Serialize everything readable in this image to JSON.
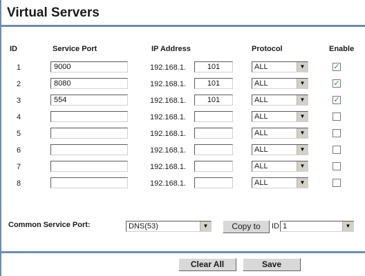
{
  "page": {
    "title": "Virtual Servers"
  },
  "table": {
    "headers": {
      "id": "ID",
      "service_port": "Service Port",
      "ip_address": "IP Address",
      "protocol": "Protocol",
      "enable": "Enable"
    },
    "ip_prefix": "192.168.1.",
    "rows": [
      {
        "id": "1",
        "port": "9000",
        "ip_suffix": "101",
        "protocol": "ALL",
        "enabled": true
      },
      {
        "id": "2",
        "port": "8080",
        "ip_suffix": "101",
        "protocol": "ALL",
        "enabled": true
      },
      {
        "id": "3",
        "port": "554",
        "ip_suffix": "101",
        "protocol": "ALL",
        "enabled": true
      },
      {
        "id": "4",
        "port": "",
        "ip_suffix": "",
        "protocol": "ALL",
        "enabled": false
      },
      {
        "id": "5",
        "port": "",
        "ip_suffix": "",
        "protocol": "ALL",
        "enabled": false
      },
      {
        "id": "6",
        "port": "",
        "ip_suffix": "",
        "protocol": "ALL",
        "enabled": false
      },
      {
        "id": "7",
        "port": "",
        "ip_suffix": "",
        "protocol": "ALL",
        "enabled": false
      },
      {
        "id": "8",
        "port": "",
        "ip_suffix": "",
        "protocol": "ALL",
        "enabled": false
      }
    ]
  },
  "common_service": {
    "label": "Common Service Port:",
    "selected": "DNS(53)",
    "copy_label": "Copy to",
    "id_label": "ID",
    "id_selected": "1"
  },
  "actions": {
    "clear_all": "Clear All",
    "save": "Save"
  },
  "icons": {
    "dropdown": "chevron-down-icon",
    "check": "check-icon"
  },
  "colors": {
    "rule": "#6c8db6",
    "check": "#2f8a2f",
    "button": "#d8d8d8"
  }
}
